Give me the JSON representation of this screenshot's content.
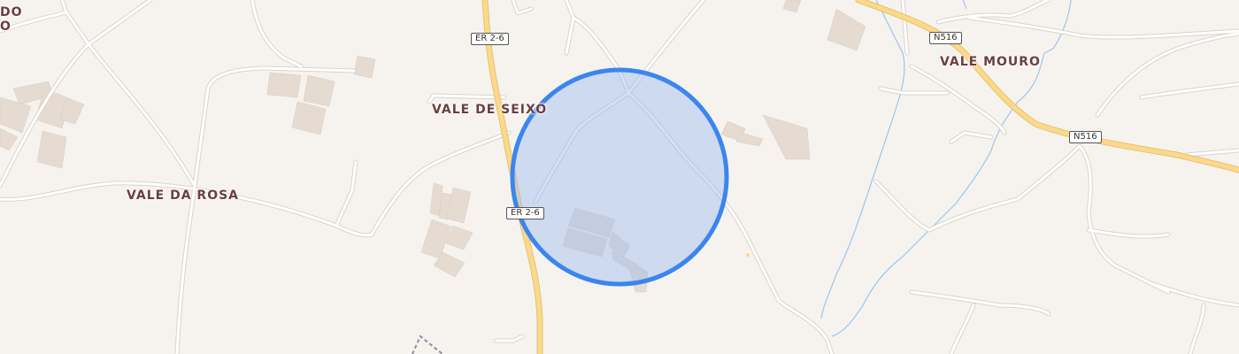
{
  "map": {
    "colors": {
      "background": "#f6f3ef",
      "minor_road": "#ffffff",
      "minor_road_casing": "#d9d3cb",
      "main_road": "#fbd98b",
      "main_road_casing": "#e6c170",
      "building": "#e6dbd1",
      "waterway": "#9ec4ec",
      "boundary": "#8d8aa5",
      "accuracy_fill": "#9bbcf0",
      "accuracy_stroke": "#3b86ee",
      "label": "#6b3e3e"
    },
    "place_labels": [
      {
        "id": "vale-de-seixo",
        "text": "VALE DE SEIXO"
      },
      {
        "id": "vale-da-rosa",
        "text": "VALE DA ROSA"
      },
      {
        "id": "vale-mouro",
        "text": "VALE MOURO"
      },
      {
        "id": "partial-do",
        "text": "DO"
      },
      {
        "id": "partial-o",
        "text": "O"
      }
    ],
    "road_shields": [
      {
        "id": "er26-top",
        "text": "ER 2-6"
      },
      {
        "id": "er26-bottom",
        "text": "ER 2-6"
      },
      {
        "id": "n516-top",
        "text": "N516"
      },
      {
        "id": "n516-right",
        "text": "N516"
      }
    ],
    "location_marker": {
      "type": "accuracy-circle"
    }
  }
}
